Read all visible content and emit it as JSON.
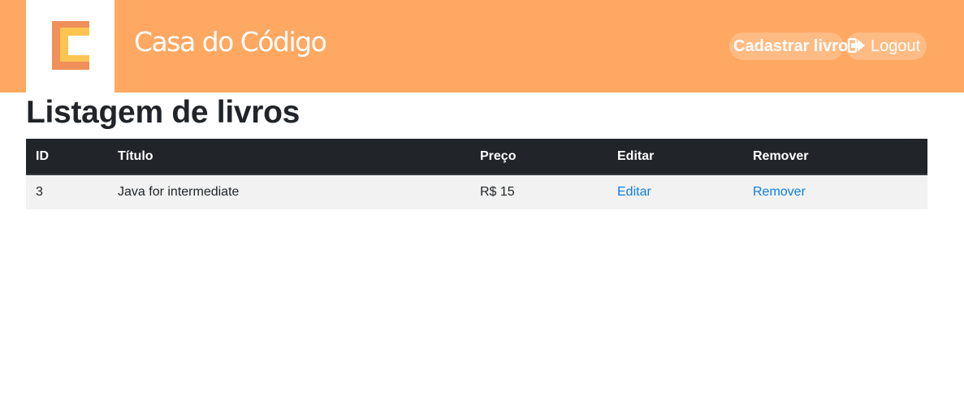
{
  "header": {
    "brand": "Casa do Código",
    "colors": {
      "header_bg": "#ffa862",
      "logo_dark": "#f0905a",
      "logo_light": "#fdc452"
    },
    "logo_icon": "casa-do-codigo-logo",
    "nav": {
      "cadastrar_label": "Cadastrar livro",
      "logout_label": "Logout",
      "logout_icon": "sign-out-icon"
    }
  },
  "main": {
    "title": "Listagem de livros",
    "table": {
      "columns": [
        "ID",
        "Título",
        "Preço",
        "Editar",
        "Remover"
      ],
      "rows": [
        {
          "id": "3",
          "titulo": "Java for intermediate",
          "preco": "R$ 15",
          "editar": "Editar",
          "remover": "Remover"
        }
      ]
    }
  }
}
